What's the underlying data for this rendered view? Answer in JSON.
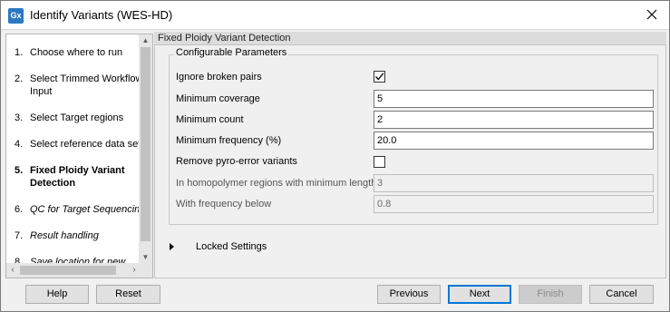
{
  "window": {
    "app_icon_text": "Gx",
    "title": "Identify Variants (WES-HD)"
  },
  "steps": [
    {
      "num": "1.",
      "label": "Choose where to run"
    },
    {
      "num": "2.",
      "label": "Select Trimmed Workflow\nInput"
    },
    {
      "num": "3.",
      "label": "Select Target regions"
    },
    {
      "num": "4.",
      "label": "Select reference data set"
    },
    {
      "num": "5.",
      "label": "Fixed Ploidy Variant\nDetection"
    },
    {
      "num": "6.",
      "label": "QC for Target Sequencing"
    },
    {
      "num": "7.",
      "label": "Result handling"
    },
    {
      "num": "8.",
      "label": "Save location for new"
    }
  ],
  "active_step": 5,
  "section": {
    "header": "Fixed Ploidy Variant Detection",
    "group_title": "Configurable Parameters",
    "params": {
      "ignore_broken_pairs": {
        "label": "Ignore broken pairs",
        "checked": true
      },
      "minimum_coverage": {
        "label": "Minimum coverage",
        "value": "5"
      },
      "minimum_count": {
        "label": "Minimum count",
        "value": "2"
      },
      "minimum_frequency": {
        "label": "Minimum frequency (%)",
        "value": "20.0"
      },
      "remove_pyro_error": {
        "label": "Remove pyro-error variants",
        "checked": false
      },
      "homopolymer_min_length": {
        "label": "In homopolymer regions with minimum length",
        "value": "3"
      },
      "frequency_below": {
        "label": "With frequency below",
        "value": "0.8"
      }
    },
    "locked_settings": "Locked Settings"
  },
  "buttons": {
    "help": "Help",
    "reset": "Reset",
    "previous": "Previous",
    "next": "Next",
    "finish": "Finish",
    "cancel": "Cancel"
  }
}
